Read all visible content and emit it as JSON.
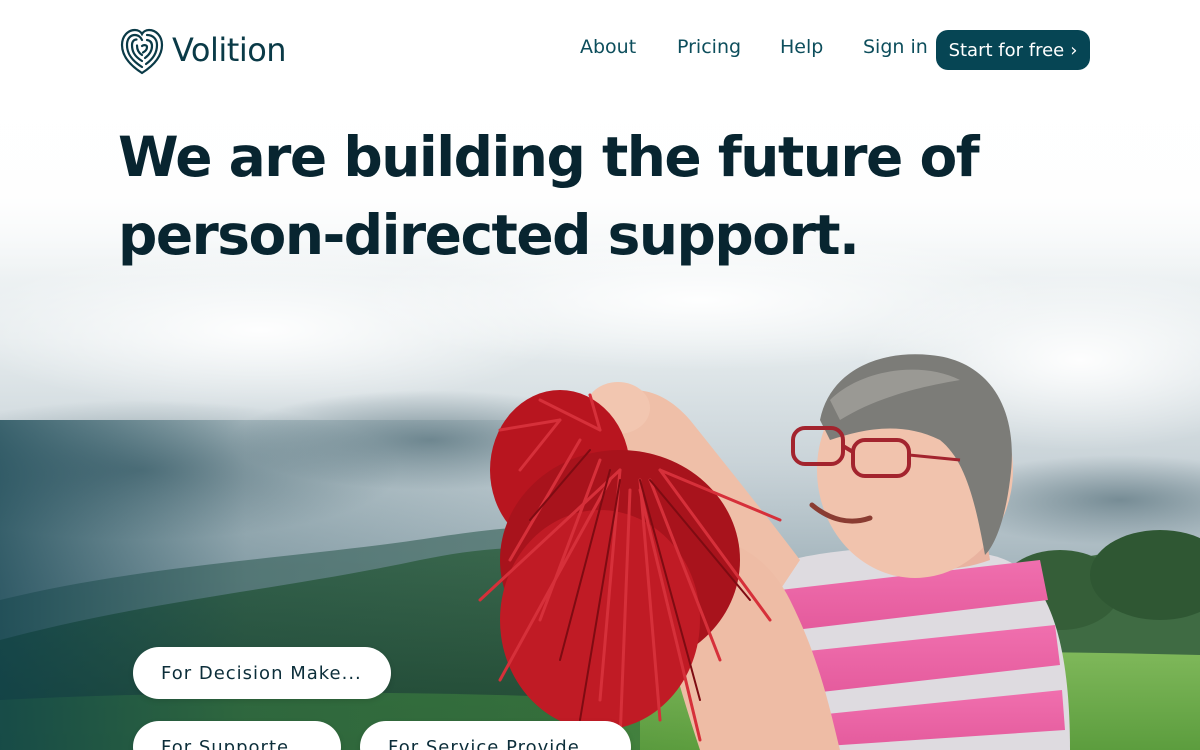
{
  "brand": {
    "name": "Volition",
    "logo_icon": "fingerprint-heart-icon",
    "primary_color": "#064554",
    "text_color": "#082530"
  },
  "nav": {
    "items": [
      {
        "label": "About"
      },
      {
        "label": "Pricing"
      },
      {
        "label": "Help"
      },
      {
        "label": "Sign in"
      }
    ],
    "cta_label": "Start for free",
    "cta_icon": "chevron-right-icon"
  },
  "hero": {
    "headline_line1": "We are building the future of",
    "headline_line2": "person-directed support.",
    "image": "smiling woman holding red pom-poms in a green field",
    "audience_buttons": [
      {
        "label": "For Decision Make..."
      },
      {
        "label": "For Supporte..."
      },
      {
        "label": "For Service Provide..."
      }
    ]
  }
}
